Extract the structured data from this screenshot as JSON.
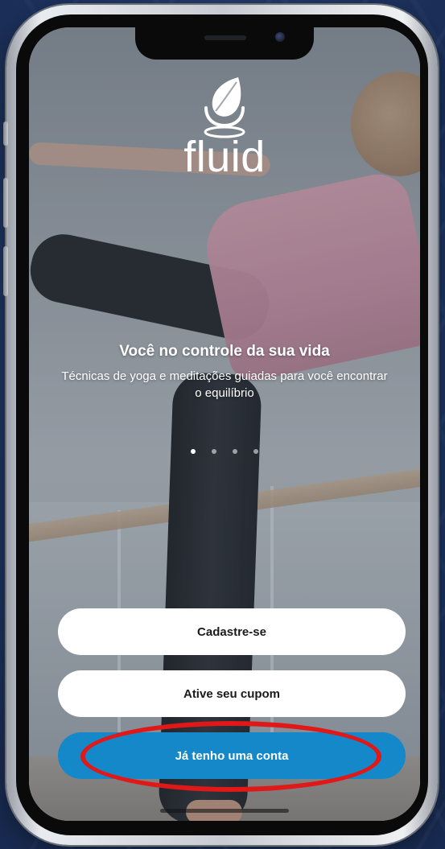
{
  "app": {
    "name": "fluid",
    "logo_icon": "leaf-lotus-icon"
  },
  "onboarding": {
    "headline": "Você no controle da sua vida",
    "subline": "Técnicas de yoga e meditações guiadas para você encontrar o equilíbrio",
    "page_indicator": {
      "total": 4,
      "current": 1
    }
  },
  "actions": {
    "signup_label": "Cadastre-se",
    "coupon_label": "Ative seu cupom",
    "login_label": "Já tenho uma conta"
  },
  "colors": {
    "primary_button": "#1488c9",
    "secondary_button": "#ffffff",
    "highlight": "#e01818"
  }
}
